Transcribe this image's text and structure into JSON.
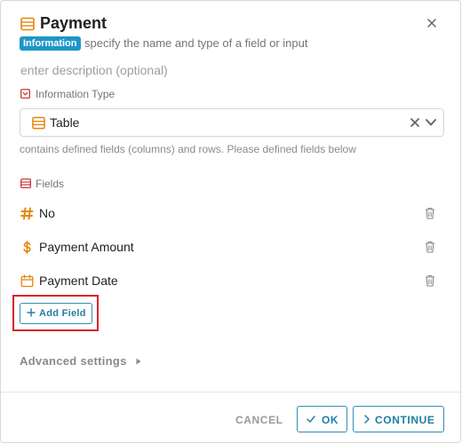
{
  "dialog": {
    "title": "Payment",
    "badge": "Information",
    "subtitle": "specify the name and type of a field or input",
    "description_placeholder": "enter description (optional)"
  },
  "info_type": {
    "label": "Information Type",
    "value": "Table",
    "helper": "contains defined fields (columns) and rows. Please defined fields below"
  },
  "fields": {
    "label": "Fields",
    "items": [
      {
        "icon": "hash-icon",
        "label": "No"
      },
      {
        "icon": "dollar-icon",
        "label": "Payment Amount"
      },
      {
        "icon": "calendar-icon",
        "label": "Payment Date"
      }
    ],
    "add_label": "Add Field"
  },
  "advanced": {
    "label": "Advanced settings"
  },
  "footer": {
    "cancel": "CANCEL",
    "ok": "OK",
    "continue": "CONTINUE"
  },
  "colors": {
    "accent": "#1f7ea3",
    "badge": "#1e96c8",
    "icon_orange": "#e8850f",
    "icon_red": "#c62828",
    "highlight": "#d9232a"
  }
}
